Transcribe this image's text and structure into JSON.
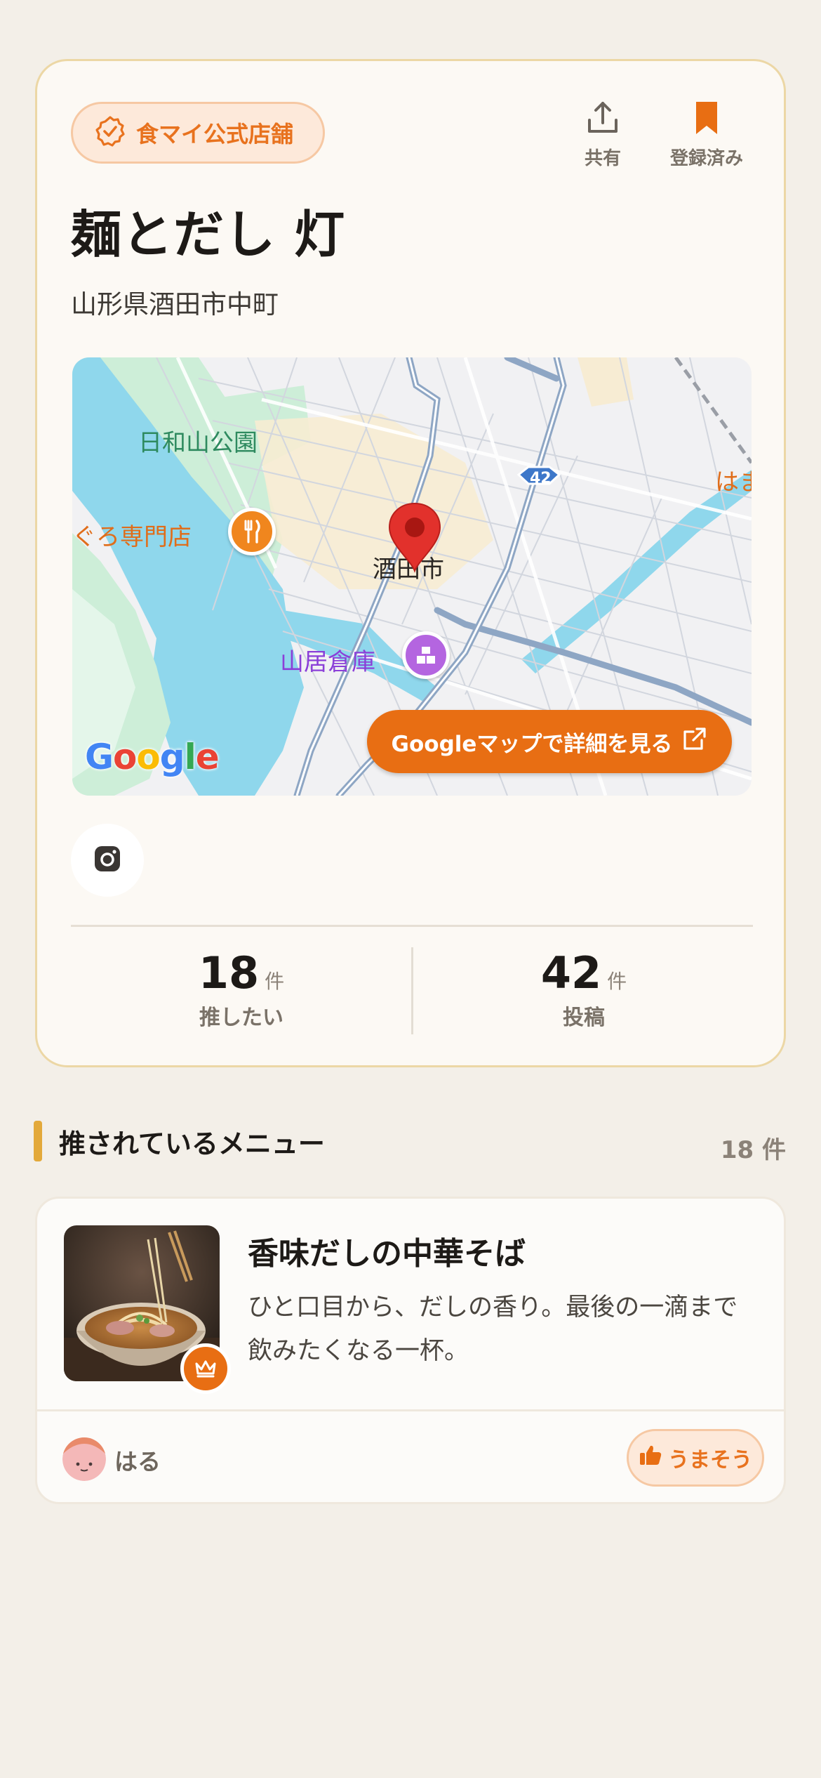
{
  "store": {
    "badge_label": "食マイ公式店舗",
    "name": "麺とだし 灯",
    "address": "山形県酒田市中町",
    "share_label": "共有",
    "bookmark_label": "登録済み"
  },
  "map": {
    "labels": {
      "park": "日和山公園",
      "restaurant": "まぐろ専門店",
      "city": "酒田市",
      "warehouse": "山居倉庫",
      "edge": "はま",
      "route": "42"
    },
    "google_logo": "Google",
    "button_label": "Googleマップで詳細を見る"
  },
  "stats": [
    {
      "value": "18",
      "unit": "件",
      "label": "推したい"
    },
    {
      "value": "42",
      "unit": "件",
      "label": "投稿"
    }
  ],
  "section": {
    "title": "推されているメニュー",
    "count": "18 件"
  },
  "menu_items": [
    {
      "name": "香味だしの中華そば",
      "description": "ひと口目から、だしの香り。最後の一滴まで飲みたくなる一杯。",
      "user": "はる",
      "like_label": "うまそう"
    }
  ],
  "colors": {
    "accent": "#e86e13",
    "badge_bg": "#fde9da",
    "card_border": "#ecd7a5",
    "section_bar": "#e3a93a"
  }
}
